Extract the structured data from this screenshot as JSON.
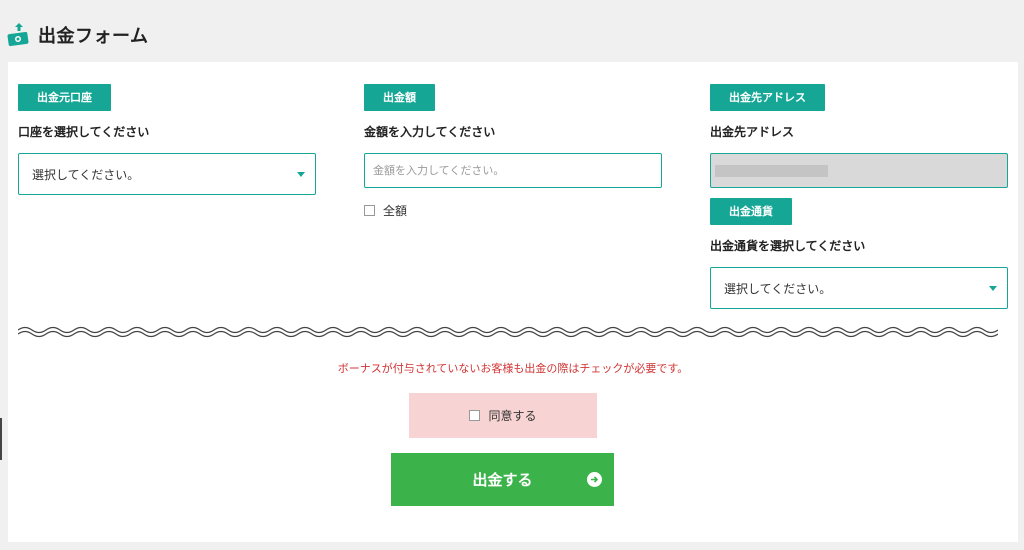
{
  "header": {
    "title": "出金フォーム",
    "icon": "money-transfer-icon"
  },
  "source_account": {
    "tag": "出金元口座",
    "label": "口座を選択してください",
    "select_value": "選択してください。"
  },
  "amount": {
    "tag": "出金額",
    "label": "金額を入力してください",
    "placeholder": "金額を入力してください。",
    "full_amount_label": "全額"
  },
  "destination": {
    "tag": "出金先アドレス",
    "label": "出金先アドレス",
    "currency_tag": "出金通貨",
    "currency_label": "出金通貨を選択してください",
    "currency_select_value": "選択してください。"
  },
  "notice": "ボーナスが付与されていないお客様も出金の際はチェックが必要です。",
  "agree_label": "同意する",
  "submit_label": "出金する",
  "colors": {
    "accent": "#16a696",
    "submit": "#3bb34a",
    "notice": "#d13535",
    "agree_bg": "#f8d3d3"
  }
}
